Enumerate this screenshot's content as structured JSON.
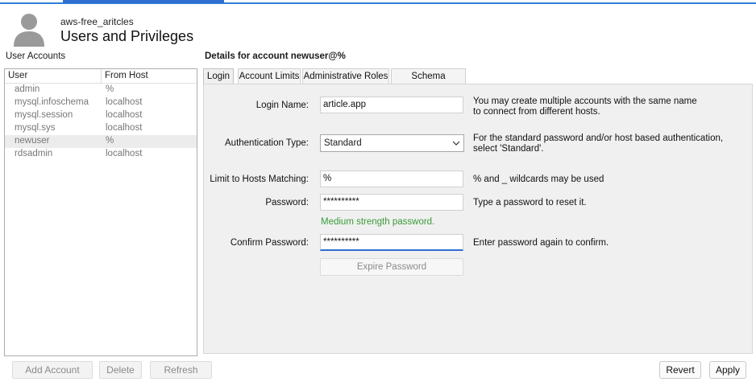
{
  "header": {
    "subtitle": "aws-free_aritcles",
    "title": "Users and Privileges"
  },
  "accounts": {
    "label": "User Accounts",
    "columns": [
      "User",
      "From Host"
    ],
    "rows": [
      {
        "user": "admin",
        "host": "%"
      },
      {
        "user": "mysql.infoschema",
        "host": "localhost"
      },
      {
        "user": "mysql.session",
        "host": "localhost"
      },
      {
        "user": "mysql.sys",
        "host": "localhost"
      },
      {
        "user": "newuser",
        "host": "%"
      },
      {
        "user": "rdsadmin",
        "host": "localhost"
      }
    ],
    "selected_index": 4,
    "buttons": {
      "add": "Add Account",
      "delete": "Delete",
      "refresh": "Refresh"
    }
  },
  "details": {
    "title": "Details for account newuser@%",
    "tabs": [
      "Login",
      "Account Limits",
      "Administrative Roles",
      "Schema Privileges"
    ],
    "active_tab": "Login",
    "login": {
      "login_name": {
        "label": "Login Name:",
        "value": "article.app",
        "hint_line1": "You may create multiple accounts with the same name",
        "hint_line2": "to connect from different hosts."
      },
      "auth_type": {
        "label": "Authentication Type:",
        "value": "Standard",
        "hint_line1": "For the standard password and/or host based authentication,",
        "hint_line2": "select 'Standard'."
      },
      "hosts": {
        "label": "Limit to Hosts Matching:",
        "value": "%",
        "hint": "% and _ wildcards may be used"
      },
      "password": {
        "label": "Password:",
        "value": "**********",
        "hint": "Type a password to reset it."
      },
      "strength": "Medium strength password.",
      "confirm": {
        "label": "Confirm Password:",
        "value": "**********",
        "hint": "Enter password again to confirm."
      },
      "expire_label": "Expire Password"
    }
  },
  "actions": {
    "revert": "Revert",
    "apply": "Apply"
  },
  "colors": {
    "accent": "#2f6fd0",
    "strength_text": "#3a9a3a"
  }
}
